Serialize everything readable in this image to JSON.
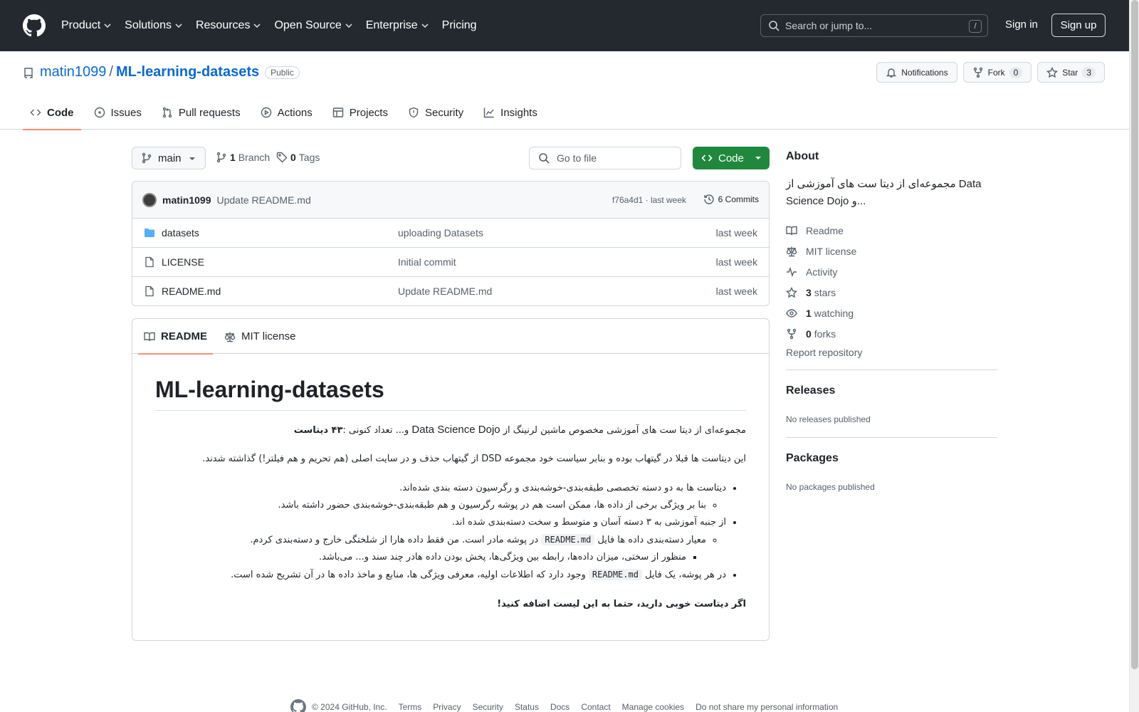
{
  "header": {
    "nav": [
      "Product",
      "Solutions",
      "Resources",
      "Open Source",
      "Enterprise",
      "Pricing"
    ],
    "search_placeholder": "Search or jump to...",
    "search_shortcut": "/",
    "signin": "Sign in",
    "signup": "Sign up"
  },
  "repo": {
    "owner": "matin1099",
    "separator": "/",
    "name": "ML-learning-datasets",
    "visibility": "Public",
    "notifications_label": "Notifications",
    "fork_label": "Fork",
    "fork_count": "0",
    "star_label": "Star",
    "star_count": "3",
    "tabs": [
      "Code",
      "Issues",
      "Pull requests",
      "Actions",
      "Projects",
      "Security",
      "Insights"
    ]
  },
  "toolbar": {
    "branch": "main",
    "branch_count": "1",
    "branch_label": "Branch",
    "tag_count": "0",
    "tag_label": "Tags",
    "goto_placeholder": "Go to file",
    "code_button": "Code"
  },
  "commit": {
    "author": "matin1099",
    "message": "Update README.md",
    "meta": "f76a4d1 · last week",
    "commits_label": "6 Commits"
  },
  "files": [
    {
      "name": "datasets",
      "type": "folder",
      "message": "uploading Datasets",
      "date": "last week"
    },
    {
      "name": "LICENSE",
      "type": "file",
      "message": "Initial commit",
      "date": "last week"
    },
    {
      "name": "README.md",
      "type": "file",
      "message": "Update README.md",
      "date": "last week"
    }
  ],
  "readme": {
    "tabs": [
      "README",
      "MIT license"
    ],
    "title": "ML-learning-datasets",
    "p1_a": "مجموعه‌ای از دیتا ست های آموزشی مخصوص ماشین لرنینگ از ",
    "p1_b": "Data Science Dojo",
    "p1_c": " و... تعداد کنونی :",
    "p1_d": "۴۳ دیتاست",
    "p2": "این دیتاست ها قبلا در گیتهاب بوده و بنابر سیاست خود مجموعه DSD از گیتهاب حذف و در سایت اصلی (هم تحریم و هم فیلتر!) گذاشته شدند.",
    "li1": "دیتاست ها به دو دسته تخصصی طبقه‌بندی-خوشه‌بندی و رگرسیون دسته بندی شده‌اند.",
    "li1_1": "بنا بر ویژگی برخی از داده ها، ممکن است هم در پوشه رگرسیون و هم طبقه‌بندی-خوشه‌بندی حضور داشته باشد.",
    "li2": "از جنبه آموزشی به ۳ دسته آسان و متوسط و سخت دسته‌بندی شده اند.",
    "li2_1_a": "معیار دسته‌بندی داده ها فایل ",
    "li2_1_code": "README.md",
    "li2_1_b": " در پوشه مادر است. من فقط داده هارا از شلختگی خارج و دسته‌بندی کردم.",
    "li2_1_1": "منظور از سختی، میزان داده‌ها، رابطه بین ویژگی‌ها، پخش بودن داده هادر چند سند و... می‌باشد.",
    "li3_a": "در هر پوشه، یک فایل ",
    "li3_code": "README.md",
    "li3_b": " وجود دارد که اطلاعات اولیه، معرفی ویژگی ها، منابع و ماخذ داده ها در آن تشریح شده است.",
    "p3": "اگر دیتاست خوبی دارید، حتما به این لیست اضافه کنید!"
  },
  "sidebar": {
    "about_title": "About",
    "about_desc": "مجموعه‌ای از دیتا ست های آموزشی از Data Science Dojo و...",
    "items": [
      {
        "icon": "book-icon",
        "strong": "",
        "label": "Readme"
      },
      {
        "icon": "law-icon",
        "strong": "",
        "label": "MIT license"
      },
      {
        "icon": "pulse-icon",
        "strong": "",
        "label": "Activity"
      },
      {
        "icon": "star-icon",
        "strong": "3",
        "label": "stars"
      },
      {
        "icon": "eye-icon",
        "strong": "1",
        "label": "watching"
      },
      {
        "icon": "fork-icon",
        "strong": "0",
        "label": "forks"
      }
    ],
    "report": "Report repository",
    "releases_title": "Releases",
    "releases_sub": "No releases published",
    "packages_title": "Packages",
    "packages_sub": "No packages published"
  },
  "footer": {
    "copyright": "© 2024 GitHub, Inc.",
    "links": [
      "Terms",
      "Privacy",
      "Security",
      "Status",
      "Docs",
      "Contact",
      "Manage cookies",
      "Do not share my personal information"
    ]
  }
}
